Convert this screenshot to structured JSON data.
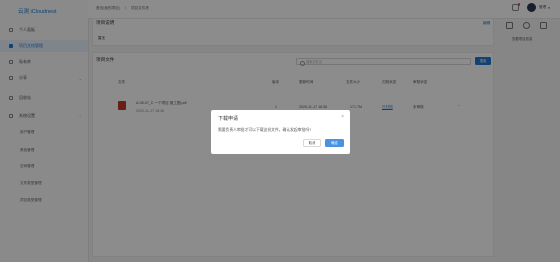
{
  "app": {
    "logo": "云测 iCloudnest"
  },
  "sidebar": {
    "items": [
      {
        "label": "个人面板",
        "icon": "person-icon"
      },
      {
        "label": "项目文档管理",
        "icon": "document-icon"
      },
      {
        "label": "私有库",
        "icon": "library-icon"
      },
      {
        "label": "分享",
        "icon": "share-icon"
      },
      {
        "label": "回收站",
        "icon": "trash-icon"
      },
      {
        "label": "系统设置",
        "icon": "gear-icon"
      }
    ],
    "subitems": [
      "用户管理",
      "角色管理",
      "空间管理",
      "文件类型管理",
      "项目类型管理"
    ]
  },
  "breadcrumb": [
    "首页(我的项目)",
    "/",
    "项目文件夹"
  ],
  "user": {
    "name": "管理"
  },
  "rightpanel": {
    "label": "查看项目信息"
  },
  "project_intro": {
    "title": "项目说明",
    "edit": "编辑",
    "content": "暂无"
  },
  "files": {
    "title": "项目文件",
    "search_placeholder": "搜索文件名",
    "search_button": "搜索",
    "columns": [
      "文件",
      "版本",
      "更新时间",
      "文件大小",
      "归档状态",
      "审核状态"
    ],
    "rows": [
      {
        "name": "A-05-07_C 一个项目 施工图.pdf",
        "date": "2020-11-17 16:36",
        "version": "1",
        "updated": "2020-11-17 16:36",
        "size": "171.7M",
        "archive": "已归档",
        "review": "未审核"
      }
    ]
  },
  "dialog": {
    "title": "下载申请",
    "message": "需要负责人审批才可以下载这份文件。确认发起审批吗?",
    "cancel": "取消",
    "ok": "确定"
  }
}
